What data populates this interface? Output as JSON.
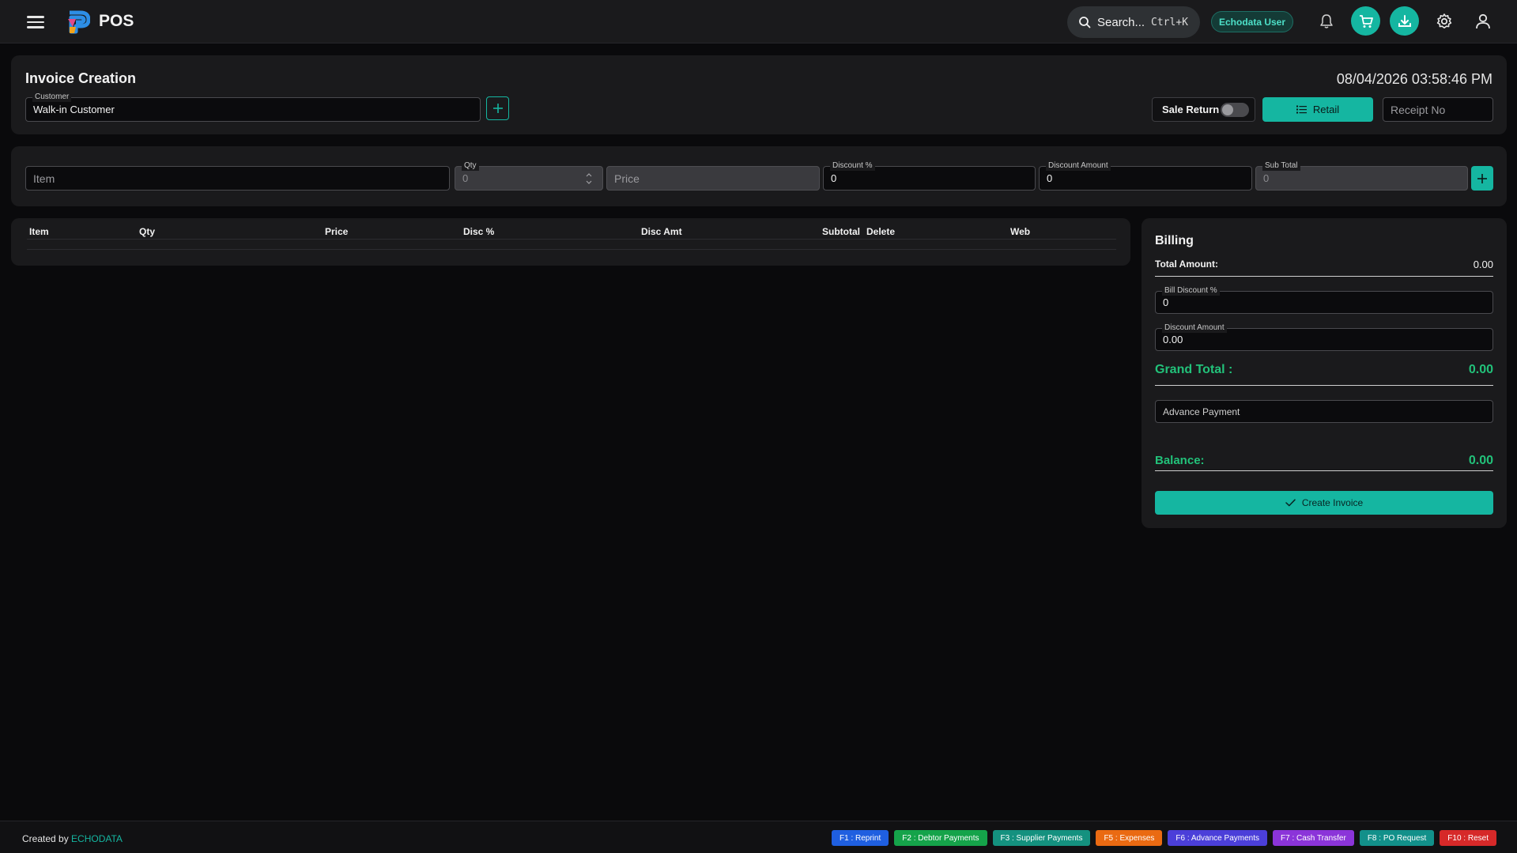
{
  "app": {
    "title": "POS"
  },
  "topbar": {
    "search_label": "Search...",
    "search_shortcut": "Ctrl+K",
    "user_name": "Echodata User",
    "icons": [
      "menu-icon",
      "logo-icon",
      "search-icon",
      "bell-icon",
      "cart-icon",
      "download-icon",
      "gear-icon",
      "user-icon"
    ]
  },
  "header": {
    "title": "Invoice Creation",
    "datetime": "08/04/2026 03:58:46 PM",
    "customer": {
      "label": "Customer",
      "value": "Walk-in Customer"
    },
    "sale_return_label": "Sale Return",
    "sale_return_on": false,
    "retail_label": "Retail",
    "receipt_placeholder": "Receipt No"
  },
  "entry": {
    "item_placeholder": "Item",
    "qty": {
      "label": "Qty",
      "value": "0"
    },
    "price_placeholder": "Price",
    "discount_pct": {
      "label": "Discount %",
      "value": "0"
    },
    "discount_amount": {
      "label": "Discount Amount",
      "value": "0"
    },
    "sub_total": {
      "label": "Sub Total",
      "value": "0"
    }
  },
  "table": {
    "columns": [
      "Item",
      "Qty",
      "Price",
      "Disc %",
      "Disc Amt",
      "Subtotal",
      "Delete",
      "Web"
    ],
    "rows": []
  },
  "billing": {
    "title": "Billing",
    "total_amount_label": "Total Amount:",
    "total_amount": "0.00",
    "bill_discount": {
      "label": "Bill Discount %",
      "value": "0"
    },
    "discount_amount": {
      "label": "Discount Amount",
      "value": "0.00"
    },
    "grand_total_label": "Grand Total :",
    "grand_total": "0.00",
    "advance_payment_placeholder": "Advance Payment",
    "balance_label": "Balance:",
    "balance": "0.00",
    "create_label": "Create Invoice"
  },
  "footer": {
    "created_by": "Created by",
    "brand": "ECHODATA",
    "fkeys": [
      {
        "label": "F1 : Reprint",
        "color": "#1f5fe0"
      },
      {
        "label": "F2 : Debtor Payments",
        "color": "#15a34a"
      },
      {
        "label": "F3 : Supplier Payments",
        "color": "#14917f"
      },
      {
        "label": "F5 : Expenses",
        "color": "#ea6a12"
      },
      {
        "label": "F6 : Advance Payments",
        "color": "#4b3fd9"
      },
      {
        "label": "F7 : Cash Transfer",
        "color": "#8b34d9"
      },
      {
        "label": "F8 : PO Request",
        "color": "#12908a"
      },
      {
        "label": "F10 : Reset",
        "color": "#d62929"
      }
    ]
  },
  "colors": {
    "accent": "#15b6a1",
    "success": "#22c27a",
    "background": "#0a0a0c",
    "card": "#1a1a1c"
  }
}
